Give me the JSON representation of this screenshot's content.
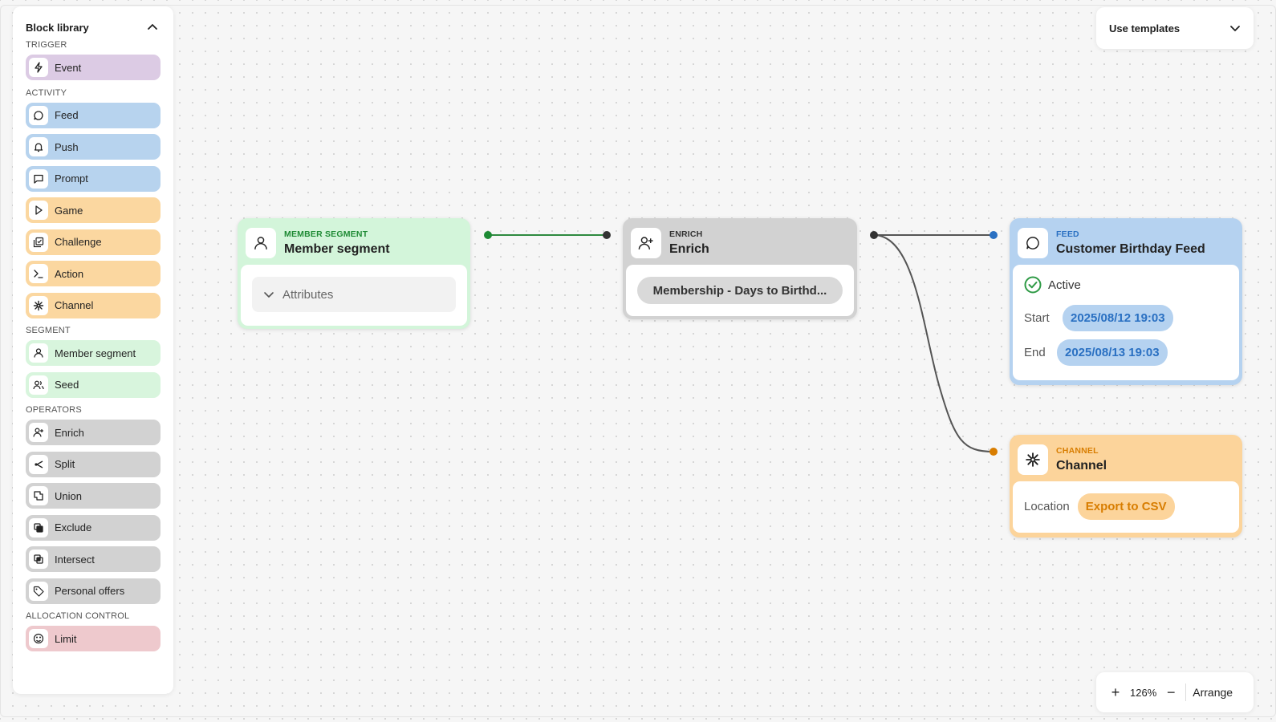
{
  "sidebar": {
    "title": "Block library",
    "sections": [
      {
        "label": "TRIGGER",
        "items": [
          {
            "label": "Event",
            "icon": "lightning-icon",
            "color": "#dccbe4"
          }
        ]
      },
      {
        "label": "ACTIVITY",
        "items": [
          {
            "label": "Feed",
            "icon": "chat-bubble-icon",
            "color": "#b7d3ee"
          },
          {
            "label": "Push",
            "icon": "bell-icon",
            "color": "#b7d3ee"
          },
          {
            "label": "Prompt",
            "icon": "message-square-icon",
            "color": "#b7d3ee"
          },
          {
            "label": "Game",
            "icon": "play-icon",
            "color": "#fbd7a0"
          },
          {
            "label": "Challenge",
            "icon": "gallery-check-icon",
            "color": "#fbd7a0"
          },
          {
            "label": "Action",
            "icon": "terminal-icon",
            "color": "#fbd7a0"
          },
          {
            "label": "Channel",
            "icon": "asterisk-icon",
            "color": "#fbd7a0"
          }
        ]
      },
      {
        "label": "SEGMENT",
        "items": [
          {
            "label": "Member segment",
            "icon": "user-icon",
            "color": "#d8f5dd"
          },
          {
            "label": "Seed",
            "icon": "users-icon",
            "color": "#d8f5dd"
          }
        ]
      },
      {
        "label": "OPERATORS",
        "items": [
          {
            "label": "Enrich",
            "icon": "user-plus-icon",
            "color": "#d2d2d2"
          },
          {
            "label": "Split",
            "icon": "split-icon",
            "color": "#d2d2d2"
          },
          {
            "label": "Union",
            "icon": "union-icon",
            "color": "#d2d2d2"
          },
          {
            "label": "Exclude",
            "icon": "exclude-icon",
            "color": "#d2d2d2"
          },
          {
            "label": "Intersect",
            "icon": "intersect-icon",
            "color": "#d2d2d2"
          },
          {
            "label": "Personal offers",
            "icon": "tag-icon",
            "color": "#d2d2d2"
          }
        ]
      },
      {
        "label": "ALLOCATION CONTROL",
        "items": [
          {
            "label": "Limit",
            "icon": "gauge-icon",
            "color": "#eec9cd"
          }
        ]
      }
    ]
  },
  "templates": {
    "label": "Use templates"
  },
  "zoom": {
    "plus": "+",
    "value": "126%",
    "minus": "−",
    "arrange": "Arrange"
  },
  "nodes": {
    "segment": {
      "type": "MEMBER SEGMENT",
      "name": "Member segment",
      "attributes_label": "Attributes",
      "color": "#d3f5da"
    },
    "enrich": {
      "type": "ENRICH",
      "name": "Enrich",
      "value": "Membership - Days to Birthd...",
      "color": "#d2d2d2"
    },
    "feed": {
      "type": "FEED",
      "name": "Customer Birthday Feed",
      "status": "Active",
      "start_label": "Start",
      "start_value": "2025/08/12 19:03",
      "end_label": "End",
      "end_value": "2025/08/13 19:03",
      "color": "#b5d2f0"
    },
    "channel": {
      "type": "CHANNEL",
      "name": "Channel",
      "location_label": "Location",
      "location_value": "Export to CSV",
      "color": "#fcd49b"
    }
  }
}
